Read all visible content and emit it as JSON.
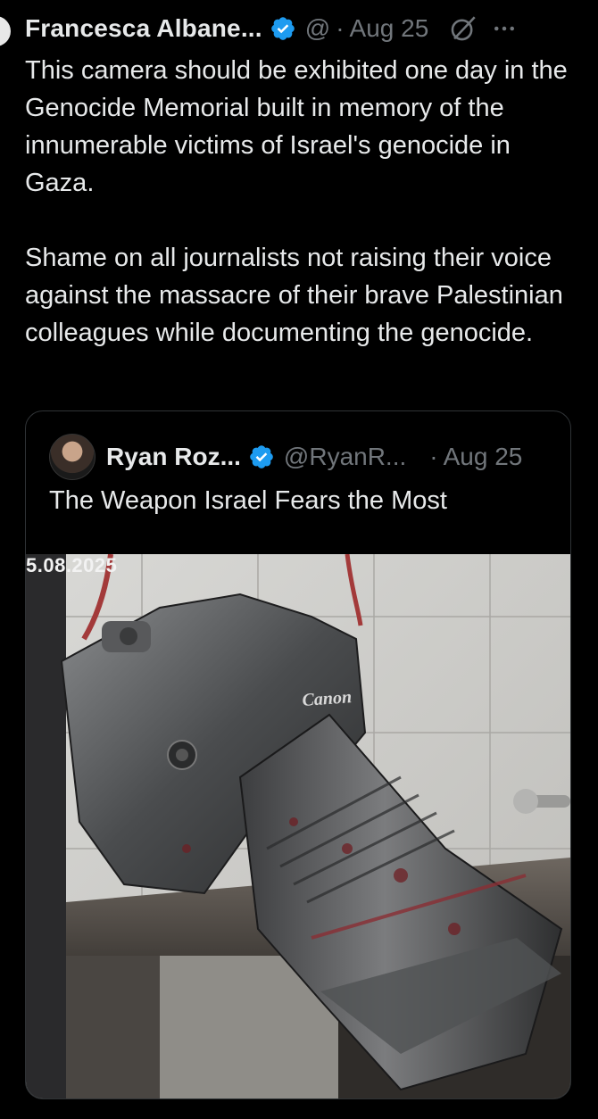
{
  "tweet": {
    "author_name": "Francesca Albane...",
    "handle": "@",
    "separator": "·",
    "date": "Aug 25",
    "paragraphs": [
      "This camera should be exhibited one day in the Genocide Memorial built in memory of the innumerable victims of Israel's genocide in Gaza.",
      "Shame on all journalists not raising their voice against the massacre of their brave Palestinian colleagues while documenting the genocide."
    ]
  },
  "quoted": {
    "author_name": "Ryan Roz...",
    "handle": "@RyanR...",
    "separator": "·",
    "date": "Aug 25",
    "text": "The Weapon Israel Fears the Most",
    "image_stamp": "5.08.2025",
    "camera_brand": "Canon"
  },
  "colors": {
    "background": "#000000",
    "text": "#e7e9ea",
    "secondary": "#71767b",
    "verified": "#1d9bf0",
    "border": "#2f3336"
  },
  "icons": [
    "verified-badge-icon",
    "grok-icon",
    "more-icon"
  ]
}
